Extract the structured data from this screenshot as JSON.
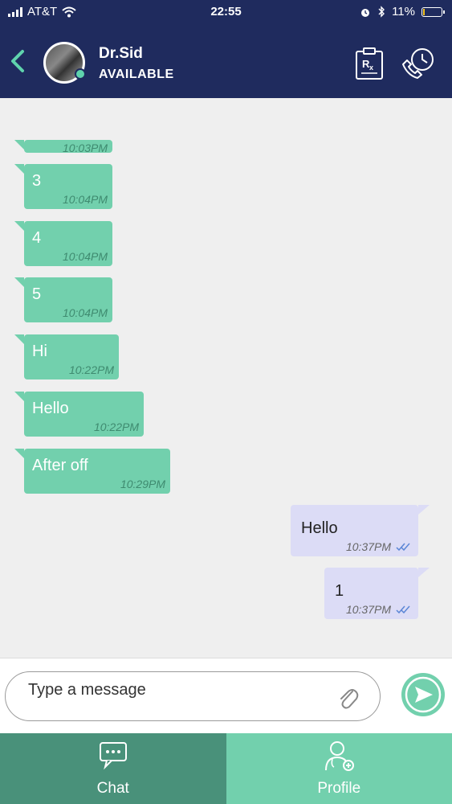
{
  "status_bar": {
    "carrier": "AT&T",
    "time": "22:55",
    "battery": "11%",
    "battery_level": 0.11
  },
  "header": {
    "name": "Dr.Sid",
    "status": "AVAILABLE"
  },
  "messages": [
    {
      "dir": "in",
      "text": "",
      "time": "10:03PM"
    },
    {
      "dir": "in",
      "text": "3",
      "time": "10:04PM"
    },
    {
      "dir": "in",
      "text": "4",
      "time": "10:04PM"
    },
    {
      "dir": "in",
      "text": "5",
      "time": "10:04PM"
    },
    {
      "dir": "in",
      "text": "Hi",
      "time": "10:22PM"
    },
    {
      "dir": "in",
      "text": "Hello",
      "time": "10:22PM"
    },
    {
      "dir": "in",
      "text": "After off",
      "time": "10:29PM"
    },
    {
      "dir": "out",
      "text": "Hello",
      "time": "10:37PM"
    },
    {
      "dir": "out",
      "text": "1",
      "time": "10:37PM"
    }
  ],
  "composer": {
    "placeholder": "Type a message"
  },
  "tabs": {
    "chat": "Chat",
    "profile": "Profile"
  },
  "colors": {
    "navy": "#1f2b5e",
    "mint": "#72d0ad",
    "dark_mint": "#49917a",
    "outgoing": "#dcdcf6"
  }
}
